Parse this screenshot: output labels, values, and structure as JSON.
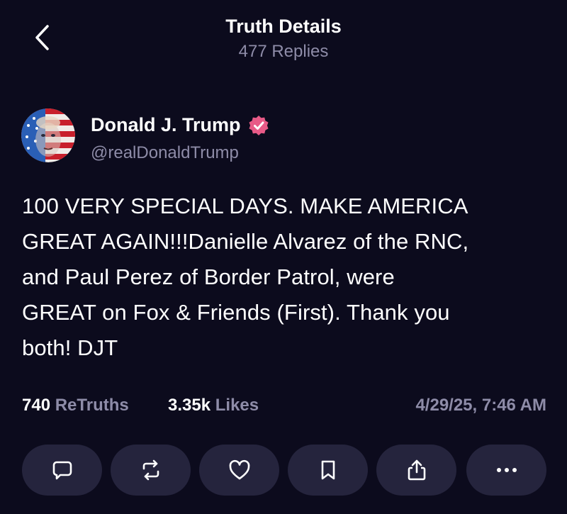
{
  "header": {
    "title": "Truth Details",
    "replies": "477 Replies"
  },
  "author": {
    "name": "Donald J. Trump",
    "handle": "@realDonaldTrump",
    "verified": true
  },
  "post": {
    "lines": [
      "100 VERY SPECIAL DAYS. MAKE AMERICA",
      "GREAT AGAIN!!!Danielle Alvarez of the RNC,",
      "and Paul Perez of Border Patrol, were",
      "GREAT on Fox & Friends (First). Thank you",
      "both! DJT"
    ]
  },
  "stats": {
    "retruths_count": "740",
    "retruths_label": "ReTruths",
    "likes_count": "3.35k",
    "likes_label": "Likes",
    "timestamp": "4/29/25, 7:46 AM"
  },
  "actions": [
    {
      "name": "reply",
      "icon": "comment-icon"
    },
    {
      "name": "retruth",
      "icon": "repost-icon"
    },
    {
      "name": "like",
      "icon": "heart-icon"
    },
    {
      "name": "bookmark",
      "icon": "bookmark-icon"
    },
    {
      "name": "share",
      "icon": "share-icon"
    },
    {
      "name": "more",
      "icon": "more-icon"
    }
  ],
  "colors": {
    "background": "#0c0b1d",
    "muted_text": "#8e8ca8",
    "button_bg": "#25243d",
    "verified_badge": "#e85a87"
  }
}
